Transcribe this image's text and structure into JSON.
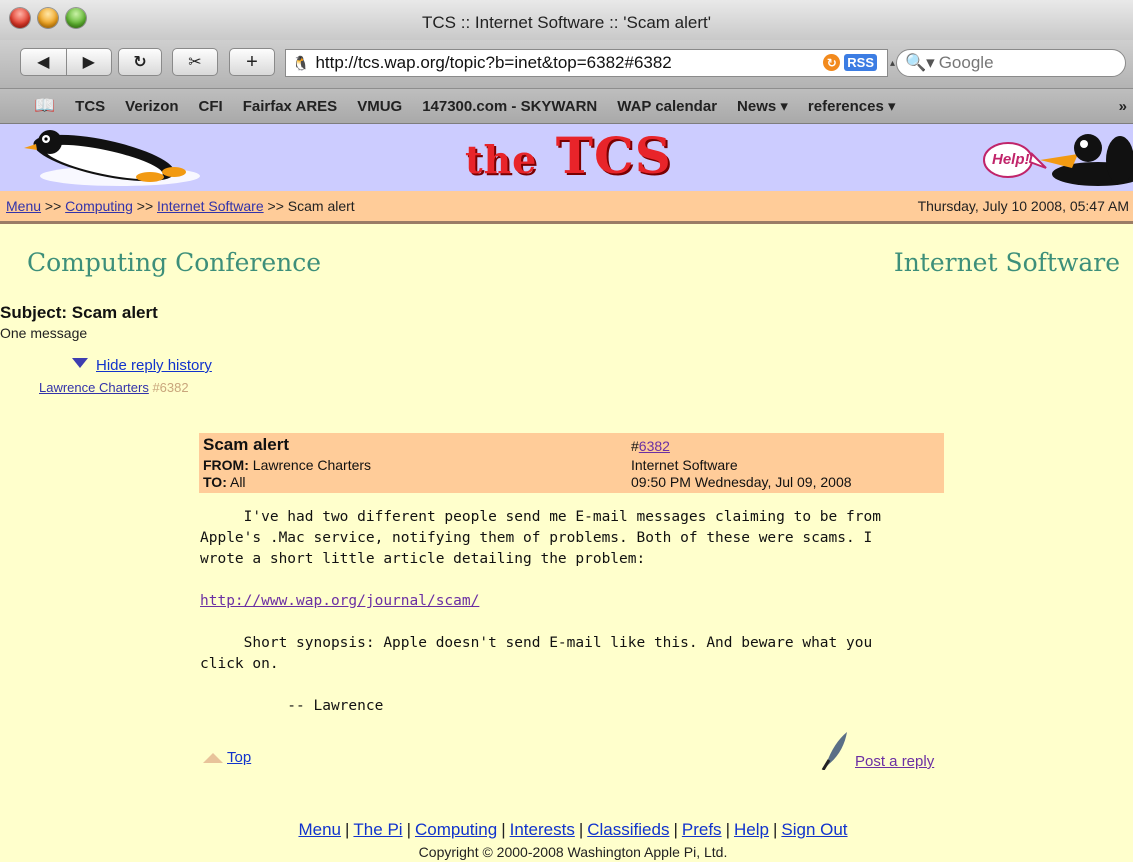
{
  "window": {
    "title": "TCS :: Internet Software :: 'Scam alert'"
  },
  "toolbar": {
    "url": "http://tcs.wap.org/topic?b=inet&top=6382#6382",
    "rss_label": "RSS",
    "search_placeholder": "Google"
  },
  "bookmarks": [
    "TCS",
    "Verizon",
    "CFI",
    "Fairfax ARES",
    "VMUG",
    "147300.com - SKYWARN",
    "WAP calendar",
    "News ▾",
    "references ▾"
  ],
  "site": {
    "logo_the": "the",
    "logo_tcs": "TCS",
    "help_label": "Help!"
  },
  "breadcrumb": {
    "menu": "Menu",
    "computing": "Computing",
    "internet_software": "Internet Software",
    "current": "Scam alert",
    "sep": ">>",
    "datetime": "Thursday, July 10 2008, 05:47 AM"
  },
  "conference": {
    "left": "Computing Conference",
    "right": "Internet Software"
  },
  "topic": {
    "subject": "Subject: Scam alert",
    "message_count": "One message",
    "hide_history": "Hide reply history",
    "thread_author": "Lawrence Charters",
    "thread_num": "#6382"
  },
  "message": {
    "title": "Scam alert",
    "from_label": "FROM:",
    "from": "Lawrence Charters",
    "to_label": "TO:",
    "to": "All",
    "num_prefix": "#",
    "num": "6382",
    "conference": "Internet Software",
    "date": "09:50 PM Wednesday, Jul 09, 2008",
    "para1": "     I've had two different people send me E-mail messages claiming to be from\nApple's .Mac service, notifying them of problems. Both of these were scams. I\nwrote a short little article detailing the problem:",
    "link": "http://www.wap.org/journal/scam/",
    "para2": "     Short synopsis: Apple doesn't send E-mail like this. And beware what you\nclick on.",
    "signature": "          -- Lawrence"
  },
  "actions": {
    "top": "Top",
    "reply": "Post a reply"
  },
  "footer": {
    "links": [
      "Menu",
      "The Pi",
      "Computing",
      "Interests",
      "Classifieds",
      "Prefs",
      "Help",
      "Sign Out"
    ],
    "copyright": "Copyright © 2000-2008 Washington Apple Pi, Ltd."
  },
  "colors": {
    "banner": "#ccccff",
    "crumbbar": "#ffcc99",
    "page": "#ffffcc",
    "conference_text": "#3d8f7a",
    "logo": "#e8242a"
  }
}
